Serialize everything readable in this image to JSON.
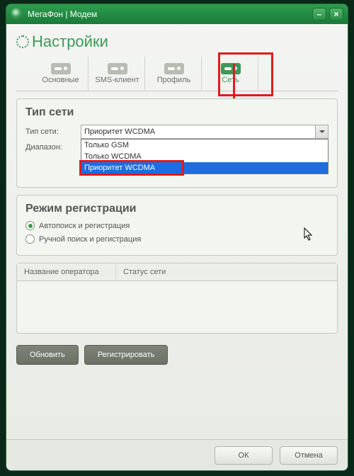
{
  "window": {
    "title": "МегаФон | Модем"
  },
  "page": {
    "title": "Настройки"
  },
  "tabs": {
    "basic": "Основные",
    "sms": "SMS-клиент",
    "profile": "Профиль",
    "network": "Сеть"
  },
  "network_type": {
    "section_title": "Тип сети",
    "type_label": "Тип сети:",
    "range_label": "Диапазон:",
    "selected": "Приоритет WCDMA",
    "options": [
      "Только GSM",
      "Только WCDMA",
      "Приоритет WCDMA"
    ]
  },
  "registration": {
    "section_title": "Режим регистрации",
    "auto": "Автопоиск и регистрация",
    "manual": "Ручной поиск и регистрация"
  },
  "table": {
    "col_operator": "Название оператора",
    "col_status": "Статус сети"
  },
  "buttons": {
    "refresh": "Обновить",
    "register": "Регистрировать",
    "ok": "ОК",
    "cancel": "Отмена"
  }
}
